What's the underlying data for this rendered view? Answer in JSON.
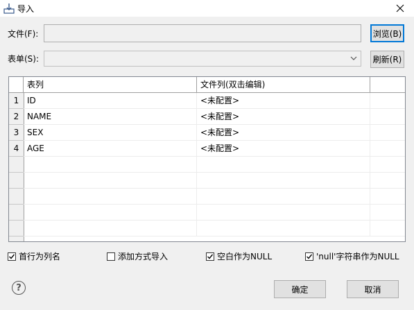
{
  "window": {
    "title": "导入",
    "icon": "import-icon",
    "close_icon": "close-icon"
  },
  "form": {
    "file_label": "文件(F):",
    "file_value": "",
    "browse_label": "浏览(B)",
    "sheet_label": "表单(S):",
    "sheet_value": "",
    "refresh_label": "刷新(R)"
  },
  "table": {
    "headers": [
      "表列",
      "文件列(双击编辑)"
    ],
    "rows": [
      {
        "num": "1",
        "column": "ID",
        "file_column": "<未配置>"
      },
      {
        "num": "2",
        "column": "NAME",
        "file_column": "<未配置>"
      },
      {
        "num": "3",
        "column": "SEX",
        "file_column": "<未配置>"
      },
      {
        "num": "4",
        "column": "AGE",
        "file_column": "<未配置>"
      }
    ]
  },
  "options": [
    {
      "label": "首行为列名",
      "checked": true
    },
    {
      "label": "添加方式导入",
      "checked": false
    },
    {
      "label": "空白作为NULL",
      "checked": true
    },
    {
      "label": "'null'字符串作为NULL",
      "checked": true
    }
  ],
  "footer": {
    "help_icon": "help-icon",
    "ok_label": "确定",
    "cancel_label": "取消"
  },
  "colors": {
    "focus_border": "#0078d7",
    "dialog_bg": "#f0f0f0"
  }
}
